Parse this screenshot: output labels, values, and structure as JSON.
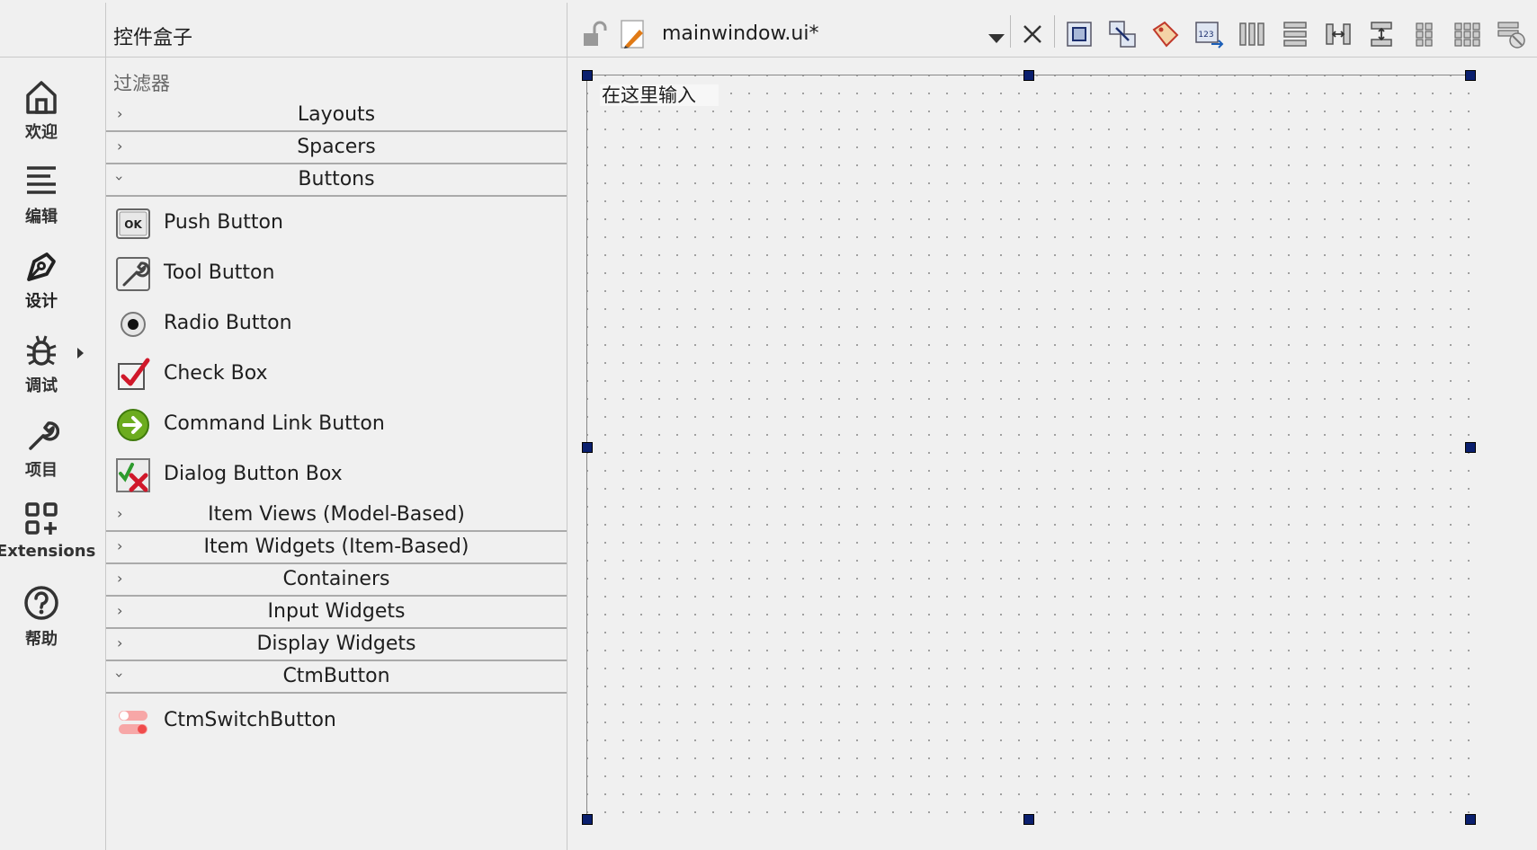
{
  "modes": [
    {
      "label": "欢迎",
      "icon": "home-icon"
    },
    {
      "label": "编辑",
      "icon": "edit-lines-icon"
    },
    {
      "label": "设计",
      "icon": "pen-icon"
    },
    {
      "label": "调试",
      "icon": "bug-icon"
    },
    {
      "label": "项目",
      "icon": "wrench-icon"
    },
    {
      "label": "Extensions",
      "icon": "extensions-icon"
    },
    {
      "label": "帮助",
      "icon": "help-icon"
    }
  ],
  "widget_box": {
    "title": "控件盒子",
    "filter_placeholder": "过滤器",
    "categories": {
      "layouts": "Layouts",
      "spacers": "Spacers",
      "buttons": "Buttons",
      "item_views": "Item Views (Model-Based)",
      "item_widgets": "Item Widgets (Item-Based)",
      "containers": "Containers",
      "input_widgets": "Input Widgets",
      "display_widgets": "Display Widgets",
      "ctmbutton": "CtmButton"
    },
    "button_items": [
      {
        "label": "Push Button",
        "icon": "push-button-icon"
      },
      {
        "label": "Tool Button",
        "icon": "tool-button-icon"
      },
      {
        "label": "Radio Button",
        "icon": "radio-button-icon"
      },
      {
        "label": "Check Box",
        "icon": "check-box-icon"
      },
      {
        "label": "Command Link Button",
        "icon": "command-link-icon"
      },
      {
        "label": "Dialog Button Box",
        "icon": "dialog-button-box-icon"
      }
    ],
    "ctm_items": [
      {
        "label": "CtmSwitchButton",
        "icon": "switch-button-icon"
      }
    ]
  },
  "designer": {
    "file_name": "mainwindow.ui*",
    "line_edit_text": "在这里输入"
  }
}
